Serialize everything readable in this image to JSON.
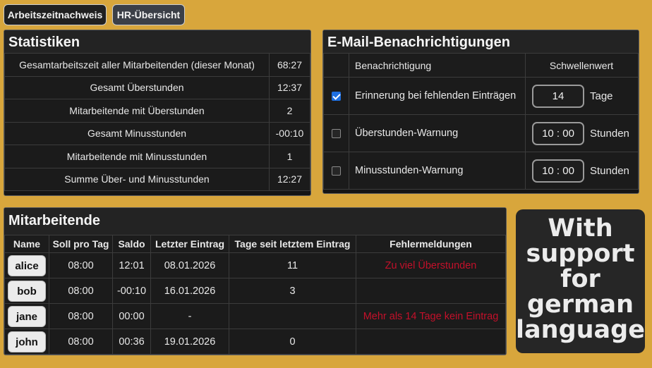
{
  "nav": {
    "tabs": [
      {
        "label": "Arbeitszeitnachweis"
      },
      {
        "label": "HR-Übersicht"
      }
    ]
  },
  "stats": {
    "title": "Statistiken",
    "rows": [
      {
        "label": "Gesamtarbeitszeit aller Mitarbeitenden (dieser Monat)",
        "value": "68:27"
      },
      {
        "label": "Gesamt Überstunden",
        "value": "12:37"
      },
      {
        "label": "Mitarbeitende mit Überstunden",
        "value": "2"
      },
      {
        "label": "Gesamt Minusstunden",
        "value": "-00:10"
      },
      {
        "label": "Mitarbeitende mit Minusstunden",
        "value": "1"
      },
      {
        "label": "Summe Über- und Minusstunden",
        "value": "12:27"
      }
    ]
  },
  "email": {
    "title": "E-Mail-Benachrichtigungen",
    "headers": {
      "notification": "Benachrichtigung",
      "threshold": "Schwellenwert"
    },
    "rows": [
      {
        "checked": true,
        "label": "Erinnerung bei fehlenden Einträgen",
        "value": "14",
        "unit": "Tage"
      },
      {
        "checked": false,
        "label": "Überstunden-Warnung",
        "value": "10 : 00",
        "unit": "Stunden"
      },
      {
        "checked": false,
        "label": "Minusstunden-Warnung",
        "value": "10 : 00",
        "unit": "Stunden"
      }
    ]
  },
  "employees": {
    "title": "Mitarbeitende",
    "headers": [
      "Name",
      "Soll pro Tag",
      "Saldo",
      "Letzter Eintrag",
      "Tage seit letztem Eintrag",
      "Fehlermeldungen"
    ],
    "rows": [
      {
        "name": "alice",
        "target": "08:00",
        "balance": "12:01",
        "last": "08.01.2026",
        "days": "11",
        "error": "Zu viel Überstunden"
      },
      {
        "name": "bob",
        "target": "08:00",
        "balance": "-00:10",
        "last": "16.01.2026",
        "days": "3",
        "error": ""
      },
      {
        "name": "jane",
        "target": "08:00",
        "balance": "00:00",
        "last": "-",
        "days": "",
        "error": "Mehr als 14 Tage kein Eintrag"
      },
      {
        "name": "john",
        "target": "08:00",
        "balance": "00:36",
        "last": "19.01.2026",
        "days": "0",
        "error": ""
      }
    ]
  },
  "promo": {
    "lines": [
      "With",
      "support",
      "for",
      "german",
      "language"
    ]
  },
  "colors": {
    "background": "#d8a63c",
    "panel": "#151515",
    "error": "#c3102a",
    "checkbox_checked": "#1e6fe0"
  }
}
